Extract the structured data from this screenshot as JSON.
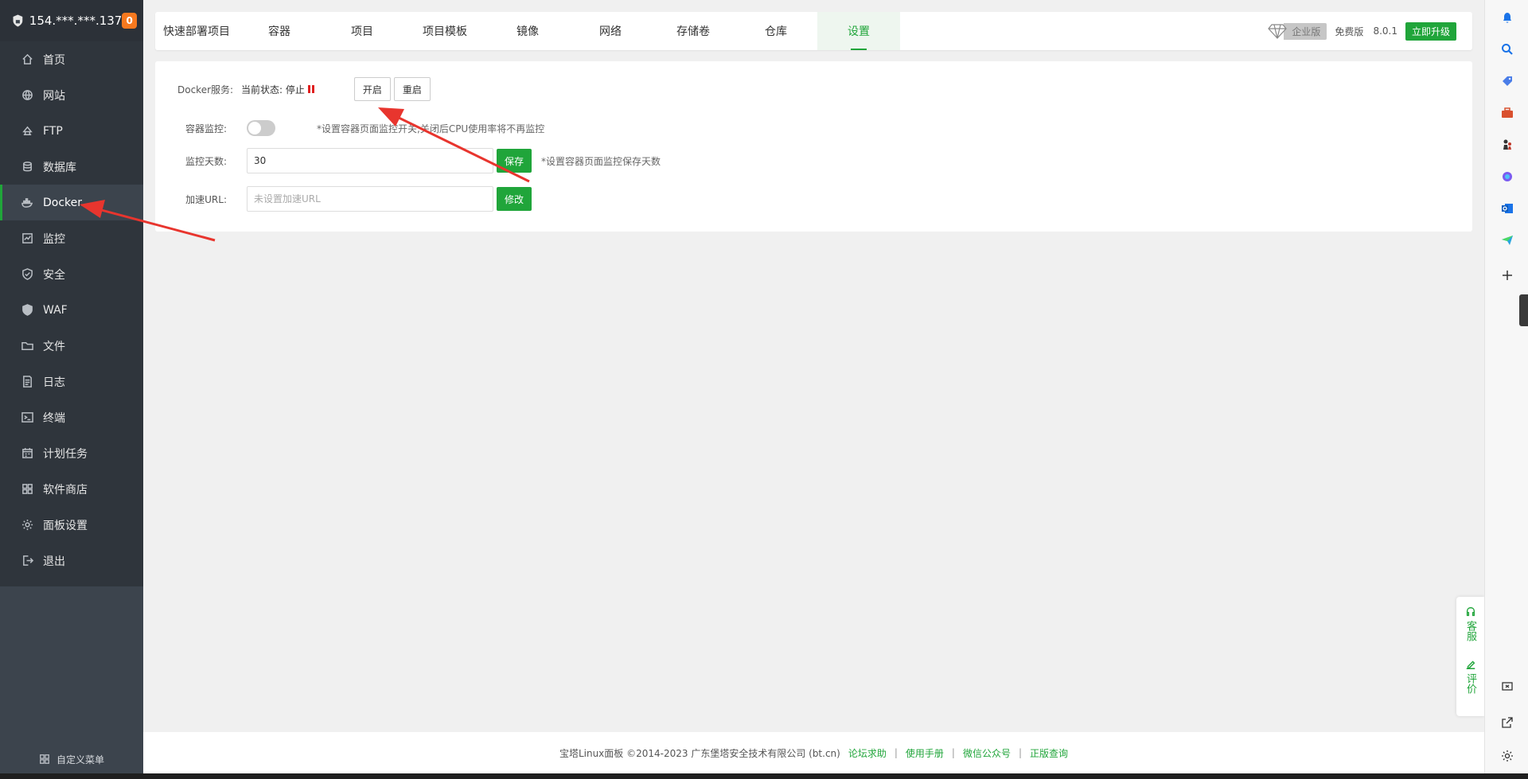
{
  "sidebar": {
    "server": "154.***.***.137",
    "badge": "0",
    "items": [
      {
        "label": "首页",
        "icon": "home-icon"
      },
      {
        "label": "网站",
        "icon": "globe-icon"
      },
      {
        "label": "FTP",
        "icon": "ftp-icon"
      },
      {
        "label": "数据库",
        "icon": "database-icon"
      },
      {
        "label": "Docker",
        "icon": "docker-icon"
      },
      {
        "label": "监控",
        "icon": "monitor-icon"
      },
      {
        "label": "安全",
        "icon": "shield-icon"
      },
      {
        "label": "WAF",
        "icon": "waf-icon"
      },
      {
        "label": "文件",
        "icon": "folder-icon"
      },
      {
        "label": "日志",
        "icon": "log-icon"
      },
      {
        "label": "终端",
        "icon": "terminal-icon"
      },
      {
        "label": "计划任务",
        "icon": "calendar-icon"
      },
      {
        "label": "软件商店",
        "icon": "grid-icon"
      },
      {
        "label": "面板设置",
        "icon": "gear-icon"
      },
      {
        "label": "退出",
        "icon": "logout-icon"
      }
    ],
    "active_index": 4,
    "footer": "自定义菜单"
  },
  "tabs": {
    "items": [
      "快速部署项目",
      "容器",
      "项目",
      "项目模板",
      "镜像",
      "网络",
      "存储卷",
      "仓库",
      "设置"
    ],
    "active_index": 8,
    "edition_badge": "企业版",
    "free_label": "免费版",
    "version": "8.0.1",
    "upgrade_label": "立即升级"
  },
  "settings": {
    "service_label": "Docker服务:",
    "status_text": "当前状态: 停止",
    "start_label": "开启",
    "restart_label": "重启",
    "monitor_label": "容器监控:",
    "monitor_hint": "*设置容器页面监控开关,关闭后CPU使用率将不再监控",
    "days_label": "监控天数:",
    "days_value": "30",
    "save_label": "保存",
    "days_hint": "*设置容器页面监控保存天数",
    "url_label": "加速URL:",
    "url_placeholder": "未设置加速URL",
    "modify_label": "修改"
  },
  "footer": {
    "copyright": "宝塔Linux面板 ©2014-2023 广东堡塔安全技术有限公司 (bt.cn)",
    "links": [
      "论坛求助",
      "使用手册",
      "微信公众号",
      "正版查询"
    ]
  },
  "float": {
    "service": "客服",
    "review": "评价"
  },
  "colors": {
    "accent": "#20a53a",
    "sidebar_bg": "#3c444d",
    "badge": "#f7791f",
    "stopped": "#e02020",
    "arrow": "#e8352e"
  }
}
